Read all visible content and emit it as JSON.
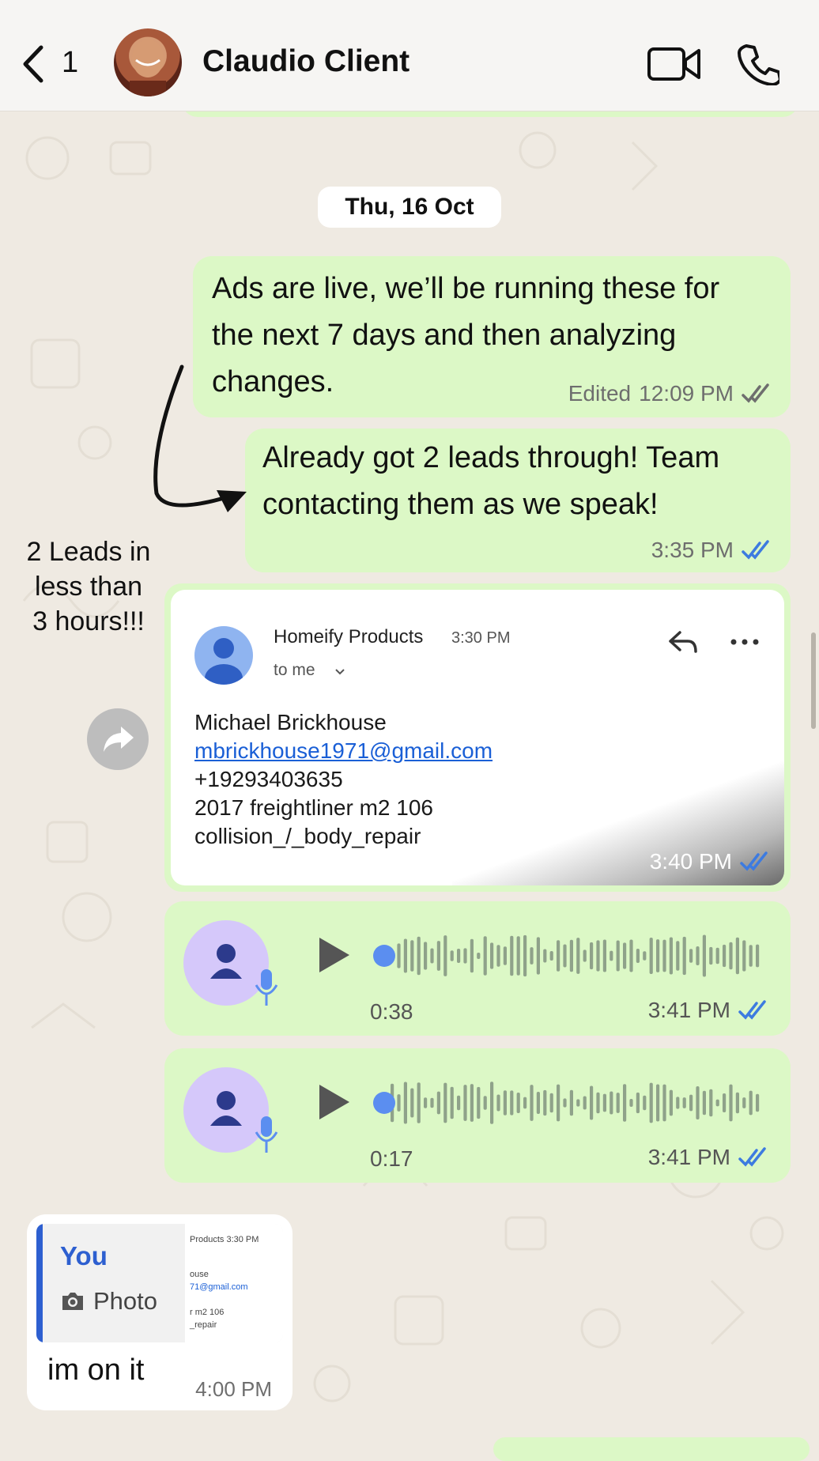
{
  "header": {
    "back_count": "1",
    "contact_name": "Claudio Client"
  },
  "date_separator": "Thu, 16 Oct",
  "messages": {
    "ads_live": {
      "text_lines": [
        "Ads are live, we’ll be running these for",
        "the next 7 days and then analyzing",
        "changes."
      ],
      "status": "Edited",
      "time": "12:09 PM"
    },
    "leads": {
      "text_lines": [
        "Already got 2 leads through! Team",
        "contacting them as we speak!"
      ],
      "time": "3:35 PM"
    },
    "email_card": {
      "sender": "Homeify Products",
      "sent_time": "3:30 PM",
      "to": "to me",
      "body": {
        "name": "Michael Brickhouse",
        "email": "mbrickhouse1971@gmail.com",
        "phone": "+19293403635",
        "vehicle": "2017 freightliner m2 106",
        "service": "collision_/_body_repair"
      },
      "time": "3:40 PM"
    },
    "voice_1": {
      "duration": "0:38",
      "time": "3:41 PM"
    },
    "voice_2": {
      "duration": "0:17",
      "time": "3:41 PM"
    },
    "reply": {
      "quote_author": "You",
      "quote_type": "Photo",
      "quote_thumb_lines": [
        "Products  3:30 PM",
        "ouse",
        "71@gmail.com",
        "r m2 106",
        "_repair"
      ],
      "text": "im on it",
      "time": "4:00 PM"
    }
  },
  "annotation": {
    "lines": [
      "2 Leads in",
      "less than",
      "3 hours!!!"
    ]
  },
  "colors": {
    "chat_bg": "#efeae2",
    "outgoing_bubble": "#dcf8c6",
    "read_ticks": "#3d7be0",
    "link": "#1a5fd6",
    "voice_avatar": "#d5c8fa"
  },
  "icons": [
    "chevron-left-icon",
    "video-camera-icon",
    "phone-icon",
    "double-check-icon",
    "forward-icon",
    "reply-icon",
    "more-icon",
    "play-icon",
    "microphone-icon",
    "camera-icon",
    "person-icon"
  ]
}
